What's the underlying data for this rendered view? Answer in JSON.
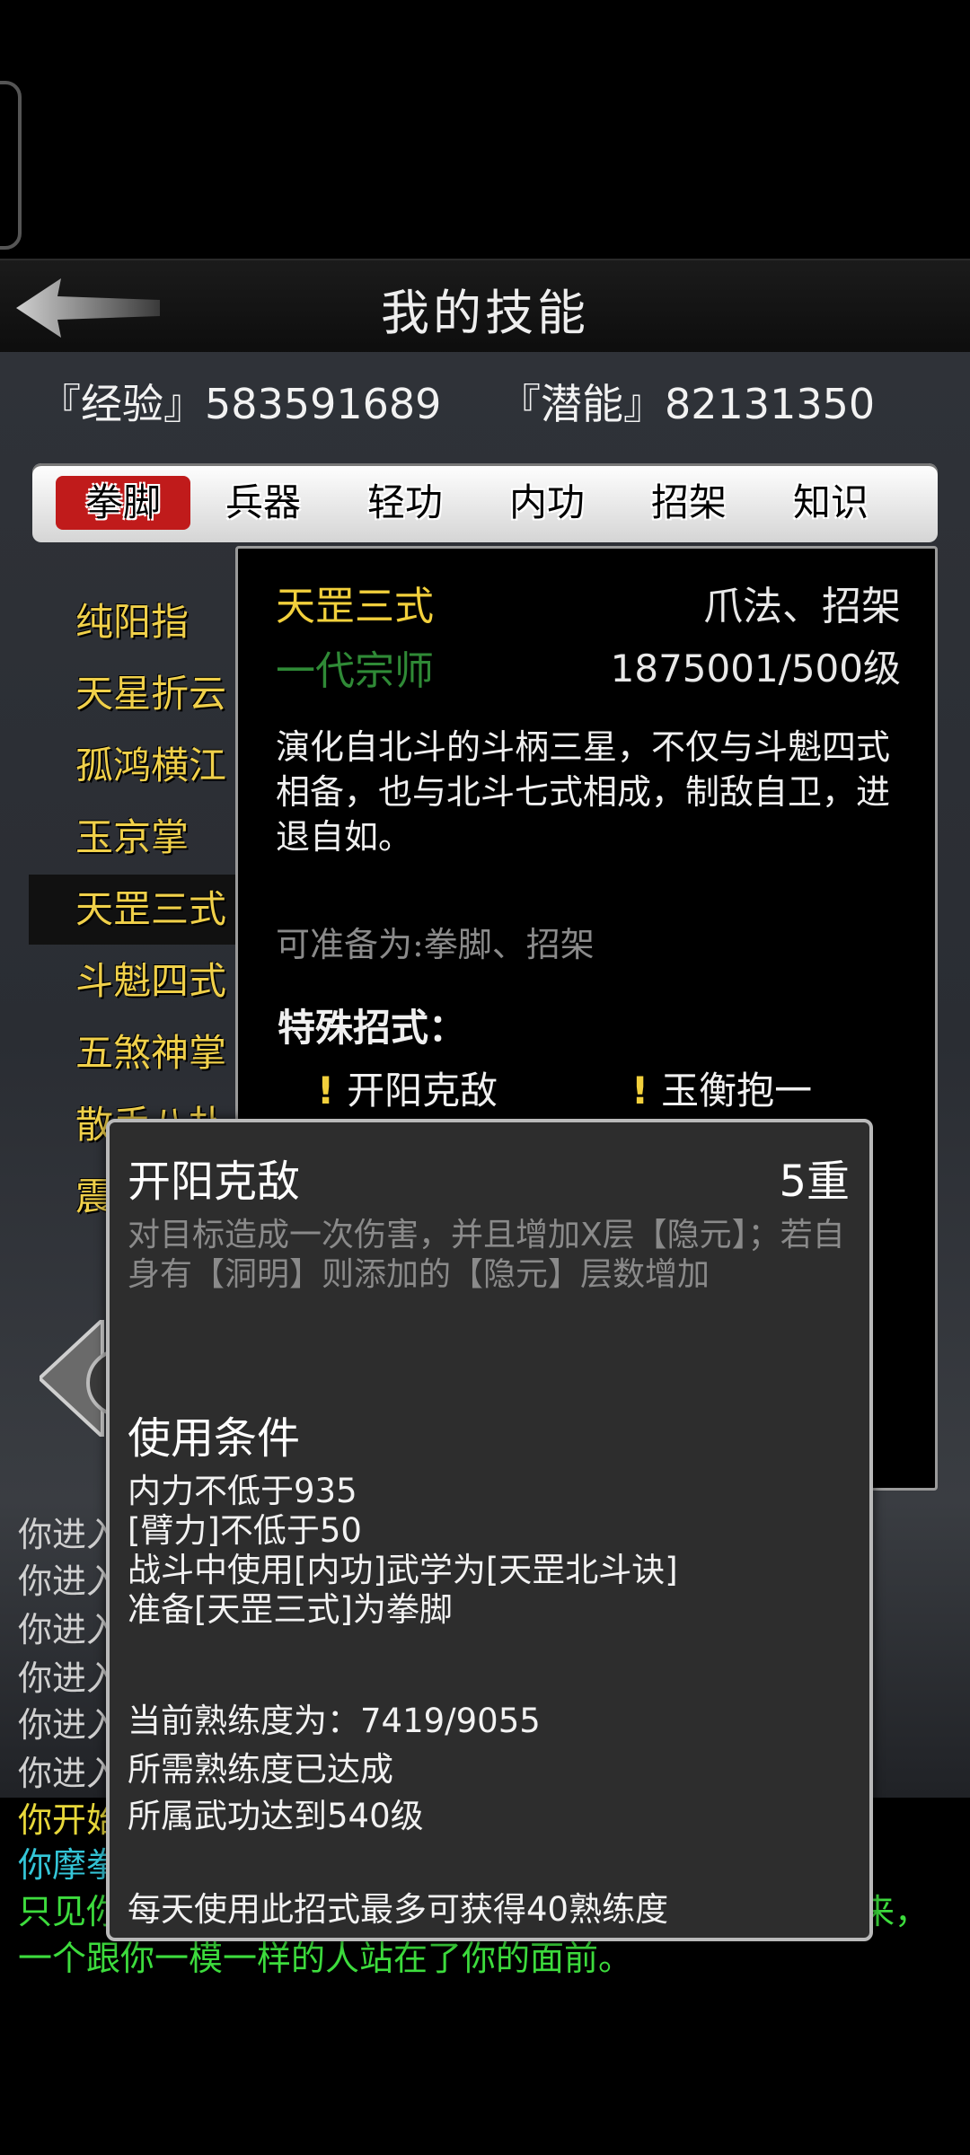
{
  "header": {
    "title": "我的技能"
  },
  "stats": {
    "exp": "『经验』583591689",
    "potential": "『潜能』82131350"
  },
  "tabs": [
    {
      "label": "拳脚",
      "active": true
    },
    {
      "label": "兵器",
      "active": false
    },
    {
      "label": "轻功",
      "active": false
    },
    {
      "label": "内功",
      "active": false
    },
    {
      "label": "招架",
      "active": false
    },
    {
      "label": "知识",
      "active": false
    }
  ],
  "skill_list": [
    {
      "label": "纯阳指"
    },
    {
      "label": "天星折云"
    },
    {
      "label": "孤鸿横江"
    },
    {
      "label": "玉京掌"
    },
    {
      "label": "天罡三式",
      "selected": true
    },
    {
      "label": "斗魁四式"
    },
    {
      "label": "五煞神掌"
    },
    {
      "label": "散手八扑"
    },
    {
      "label": "震"
    }
  ],
  "detail": {
    "name": "天罡三式",
    "type": "爪法、招架",
    "rank": "一代宗师",
    "level": "1875001/500级",
    "description": "演化自北斗的斗柄三星，不仅与斗魁四式相备，也与北斗七式相成，制敌自卫，进退自如。",
    "prepare": "可准备为:拳脚、招架",
    "special_title": "特殊招式：",
    "moves": [
      "开阳克敌",
      "玉衡抱一"
    ]
  },
  "tooltip": {
    "name": "开阳克敌",
    "level": "5重",
    "description": "对目标造成一次伤害，并且增加X层【隐元】；若自身有【洞明】则添加的【隐元】层数增加",
    "conditions_title": "使用条件",
    "conditions": [
      "内力不低于935",
      "[臂力]不低于50",
      "战斗中使用[内功]武学为[天罡北斗诀]",
      "准备[天罡三式]为拳脚"
    ],
    "proficiency": "当前熟练度为：7419/9055",
    "proficiency_status": "所需熟练度已达成",
    "skill_req": "所属武功达到540级",
    "daily": "每天使用此招式最多可获得40熟练度"
  },
  "chat": [
    {
      "text": "你进入",
      "color": "#d0d0d0"
    },
    {
      "text": "你进入",
      "color": "#d0d0d0"
    },
    {
      "text": "你进入",
      "color": "#d0d0d0"
    },
    {
      "text": "你进入",
      "color": "#d0d0d0"
    },
    {
      "text": "你进入",
      "color": "#d0d0d0"
    },
    {
      "text": "你进入",
      "color": "#d0d0d0"
    },
    {
      "text": "你开始",
      "color": "#e8d83a"
    },
    {
      "text": "你摩拳",
      "color": "#34c6d8"
    },
    {
      "text": "只见你",
      "color": "#3ddc3d"
    },
    {
      "text": "来，",
      "color": "#3ddc3d"
    },
    {
      "text": "一个跟你一模一样的人站在了你的面前。",
      "color": "#3ddc3d"
    }
  ],
  "colors": {
    "gold": "#f2d03c",
    "active_tab": "#c01b1b",
    "rank_green": "#2f8a36"
  }
}
